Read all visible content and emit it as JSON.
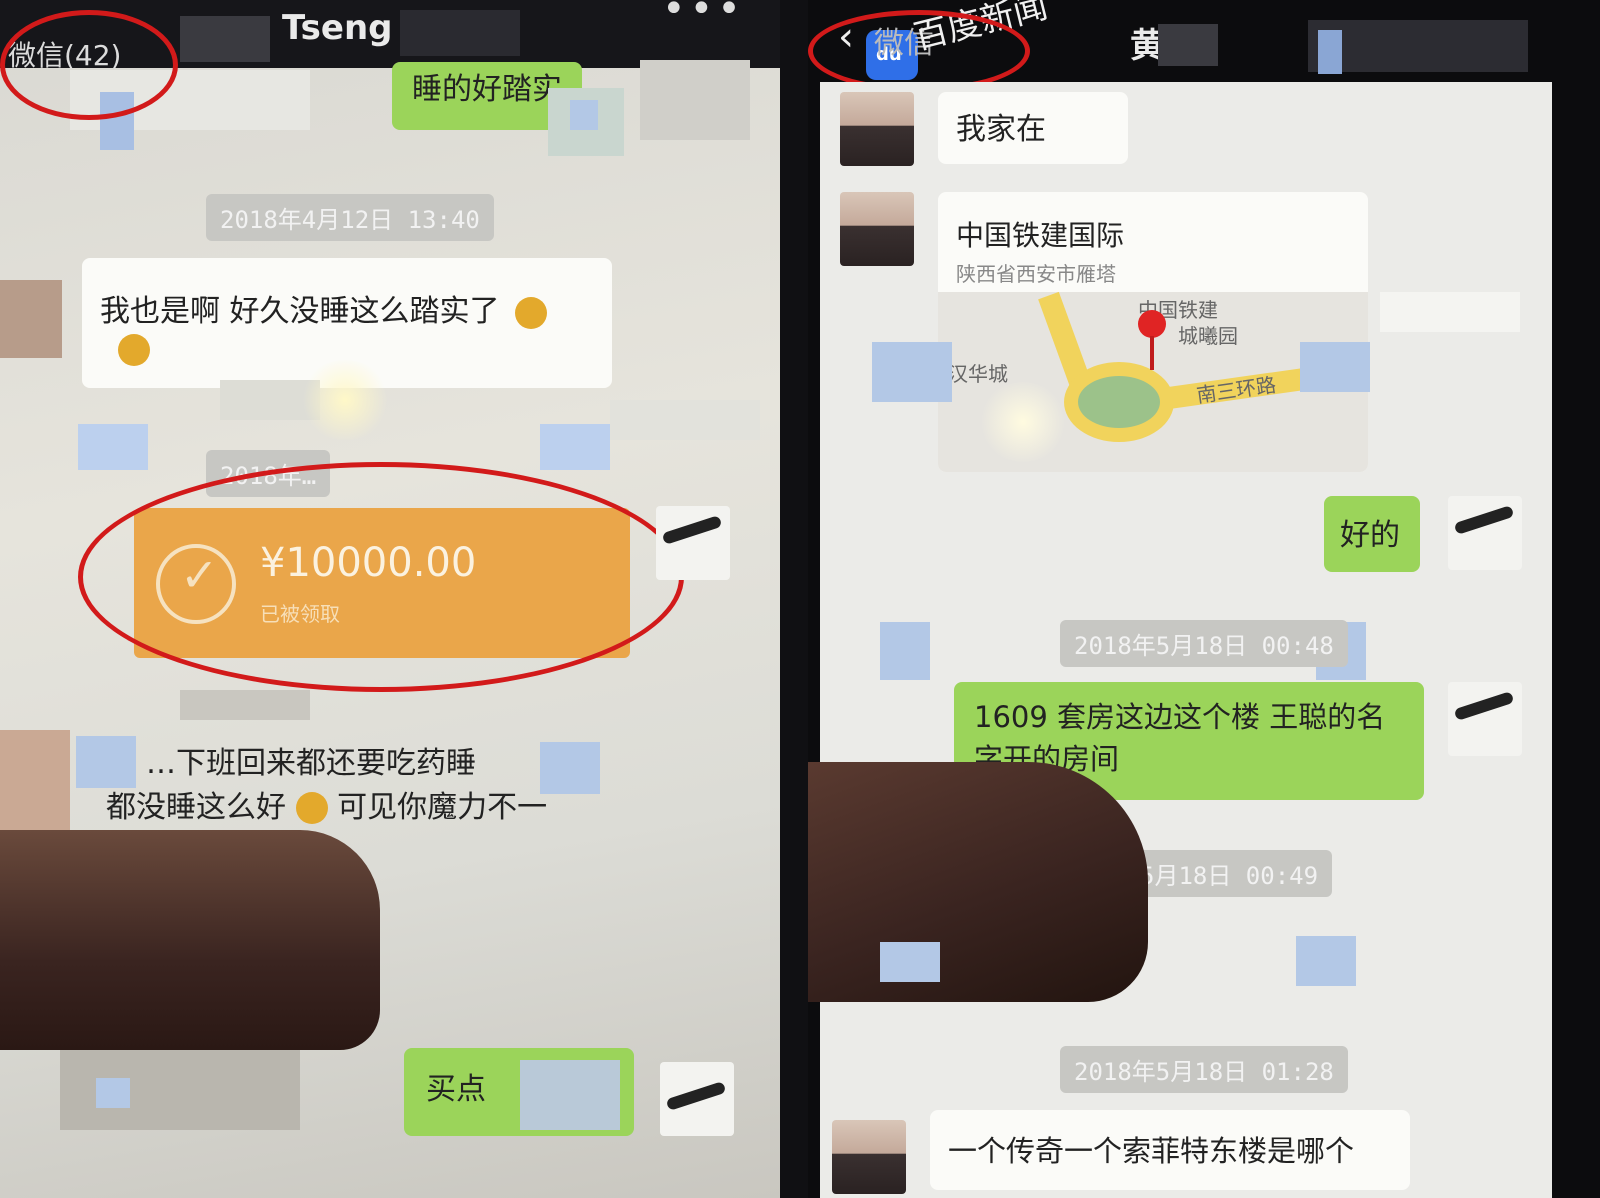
{
  "left": {
    "header": {
      "back_label": "微信(42)",
      "title": "Tseng",
      "more_icon": "more-dots-icon"
    },
    "messages": {
      "top_green": "睡的好踏实",
      "timestamp_1": "2018年4月12日 13:40",
      "incoming_1_line1": "我也是啊 好久没睡这么踏实了",
      "timestamp_2": "2018年…",
      "transfer_amount": "¥10000.00",
      "transfer_status": "已被领取",
      "incoming_2_line1": "…下班回来都还要吃药睡",
      "incoming_2_line2": "都没睡这么好",
      "incoming_2_line3": "可见你魔力不一",
      "bottom_green": "买点"
    }
  },
  "right": {
    "header": {
      "back_label": "微信",
      "overlay_text": "百度新闻",
      "title": "黄",
      "logo_text": "du"
    },
    "messages": {
      "incoming_1": "我家在",
      "location_title": "中国铁建国际",
      "location_subtitle": "陕西省西安市雁塔",
      "map_label_1": "中国铁建",
      "map_label_2": "城曦园",
      "map_label_3": "汉华城",
      "map_label_4": "南三环路",
      "outgoing_1": "好的",
      "timestamp_1": "2018年5月18日 00:48",
      "outgoing_2_line1": "1609 套房这边这个楼 王聪的名",
      "outgoing_2_line2": "字开的房间",
      "timestamp_2": "年5月18日 00:49",
      "timestamp_3": "2018年5月18日 01:28",
      "incoming_2": "一个传奇一个索菲特东楼是哪个"
    }
  },
  "colors": {
    "annotation": "#d21a1a",
    "wechat_green": "#9bd45a",
    "transfer_orange": "#eaa64a"
  }
}
